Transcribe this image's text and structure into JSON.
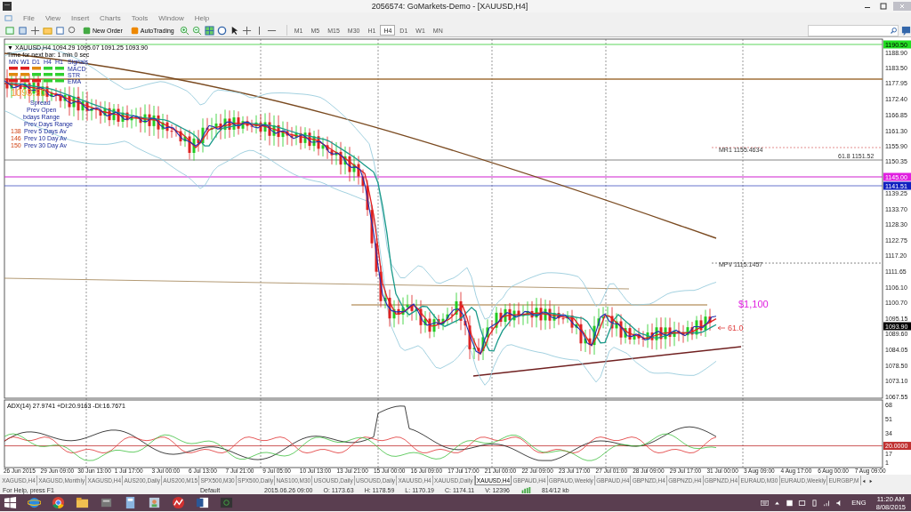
{
  "window": {
    "title": "2056574: GoMarkets-Demo - [XAUUSD,H4]"
  },
  "menu": [
    "File",
    "View",
    "Insert",
    "Charts",
    "Tools",
    "Window",
    "Help"
  ],
  "toolbar": {
    "buttons": [
      {
        "label": "New Order"
      },
      {
        "label": "AutoTrading"
      }
    ],
    "timeframes": [
      {
        "label": "M1",
        "selected": false
      },
      {
        "label": "M5",
        "selected": false
      },
      {
        "label": "M15",
        "selected": false
      },
      {
        "label": "M30",
        "selected": false
      },
      {
        "label": "H1",
        "selected": false
      },
      {
        "label": "H4",
        "selected": true
      },
      {
        "label": "D1",
        "selected": false
      },
      {
        "label": "W1",
        "selected": false
      },
      {
        "label": "MN",
        "selected": false
      }
    ]
  },
  "chart": {
    "collapse": "▼",
    "header": "XAUUSD,H4  1094.29 1095.07 1091.25 1093.90",
    "timer": "Time for next bar: 1 min 0 sec",
    "signal_columns": [
      "MN",
      "W1",
      "D1",
      "H4",
      "H1"
    ],
    "signal_header": "Signals",
    "signal_rows": [
      {
        "label": "MACD",
        "cells": [
          {
            "color": "#e02020"
          },
          {
            "color": "#e02020"
          },
          {
            "color": "#e08a10"
          },
          {
            "color": "#30d030"
          },
          {
            "color": "#30d030"
          }
        ]
      },
      {
        "label": "STR",
        "cells": [
          {
            "color": "#e08a10"
          },
          {
            "color": "#e08a10"
          },
          {
            "color": "#30d030"
          },
          {
            "color": "#30d030"
          },
          {
            "color": "#30d030"
          }
        ]
      },
      {
        "label": "EMA",
        "cells": [
          {
            "color": "#e02020"
          },
          {
            "color": "#e02020"
          },
          {
            "color": "#e02020"
          },
          {
            "color": "#30d030"
          },
          {
            "color": "#30d030"
          }
        ]
      }
    ],
    "price_display": "1093.90",
    "info_labels": [
      "Spread",
      "Prev Open",
      "bdays Range",
      "Prev Days Range",
      "Prev 5 Days Av",
      "Prev 10 Day Av",
      "Prev 30 Day Av"
    ],
    "info_numbers": [
      "138",
      "146",
      "150"
    ],
    "price_axis": [
      "1188.90",
      "1183.50",
      "1177.95",
      "1172.40",
      "1166.85",
      "1161.30",
      "1155.90",
      "1150.35",
      "1139.25",
      "1133.70",
      "1128.30",
      "1122.75",
      "1117.20",
      "1111.65",
      "1106.10",
      "1100.70",
      "1095.15",
      "1089.60",
      "1084.05",
      "1078.50",
      "1073.10",
      "1067.55"
    ],
    "price_tags": [
      {
        "text": "1190.50",
        "color": "#22dd22"
      },
      {
        "text": "1145.00",
        "color": "#e020e0"
      },
      {
        "text": "1141.51",
        "color": "#1020c0"
      },
      {
        "text": "1093.90",
        "color": "#000000"
      }
    ],
    "levels": [
      {
        "text": "MR1  1155.4634"
      },
      {
        "text": "61.8  1151.52"
      },
      {
        "text": "MPV  1115.1457"
      }
    ],
    "annotations": [
      {
        "text": "$1,100"
      },
      {
        "text": "61.0"
      }
    ],
    "indicator": {
      "title": "ADX(14) 27.9741 +DI:20.9163 -DI:16.7671",
      "axis": [
        "68",
        "51",
        "34",
        "17",
        "1"
      ],
      "level_tag": "20.0000"
    },
    "time_axis": [
      "26 Jun 2015",
      "29 Jun 09:00",
      "30 Jun 13:00",
      "1 Jul 17:00",
      "3 Jul 00:00",
      "6 Jul 13:00",
      "7 Jul 21:00",
      "9 Jul 05:00",
      "10 Jul 13:00",
      "13 Jul 21:00",
      "15 Jul 00:00",
      "16 Jul 09:00",
      "17 Jul 17:00",
      "21 Jul 00:00",
      "22 Jul 09:00",
      "23 Jul 17:00",
      "27 Jul 01:00",
      "28 Jul 09:00",
      "29 Jul 17:00",
      "31 Jul 00:00",
      "3 Aug 09:00",
      "4 Aug 17:00",
      "6 Aug 00:00",
      "7 Aug 09:00"
    ]
  },
  "tabs": [
    {
      "label": "XAGUSD,H4",
      "selected": false
    },
    {
      "label": "XAGUSD,Monthly",
      "selected": false
    },
    {
      "label": "XAGUSD,H4",
      "selected": false
    },
    {
      "label": "AUS200,Daily",
      "selected": false
    },
    {
      "label": "AUS200,M15",
      "selected": false
    },
    {
      "label": "SPX500,M30",
      "selected": false
    },
    {
      "label": "SPX500,Daily",
      "selected": false
    },
    {
      "label": "NAS100,M30",
      "selected": false
    },
    {
      "label": "USOUSD,Daily",
      "selected": false
    },
    {
      "label": "USOUSD,Daily",
      "selected": false
    },
    {
      "label": "XAUUSD,H4",
      "selected": false
    },
    {
      "label": "XAUUSD,Daily",
      "selected": false
    },
    {
      "label": "XAUUSD,H4",
      "selected": true
    },
    {
      "label": "GBPAUD,H4",
      "selected": false
    },
    {
      "label": "GBPAUD,Weekly",
      "selected": false
    },
    {
      "label": "GBPAUD,H4",
      "selected": false
    },
    {
      "label": "GBPNZD,H4",
      "selected": false
    },
    {
      "label": "GBPNZD,H4",
      "selected": false
    },
    {
      "label": "GBPNZD,H4",
      "selected": false
    },
    {
      "label": "EURAUD,M30",
      "selected": false
    },
    {
      "label": "EURAUD,Weekly",
      "selected": false
    },
    {
      "label": "EURGBP,M",
      "selected": false
    }
  ],
  "status_bar": {
    "help": "For Help, press F1",
    "profile": "Default",
    "fields": [
      "2015.06.26 09:00",
      "O: 1173.63",
      "H: 1178.59",
      "L: 1170.19",
      "C: 1174.11",
      "V: 12396"
    ],
    "traffic": "814/12 kb"
  },
  "taskbar": {
    "language": "ENG",
    "time": "11:20 AM",
    "date": "8/08/2015"
  }
}
